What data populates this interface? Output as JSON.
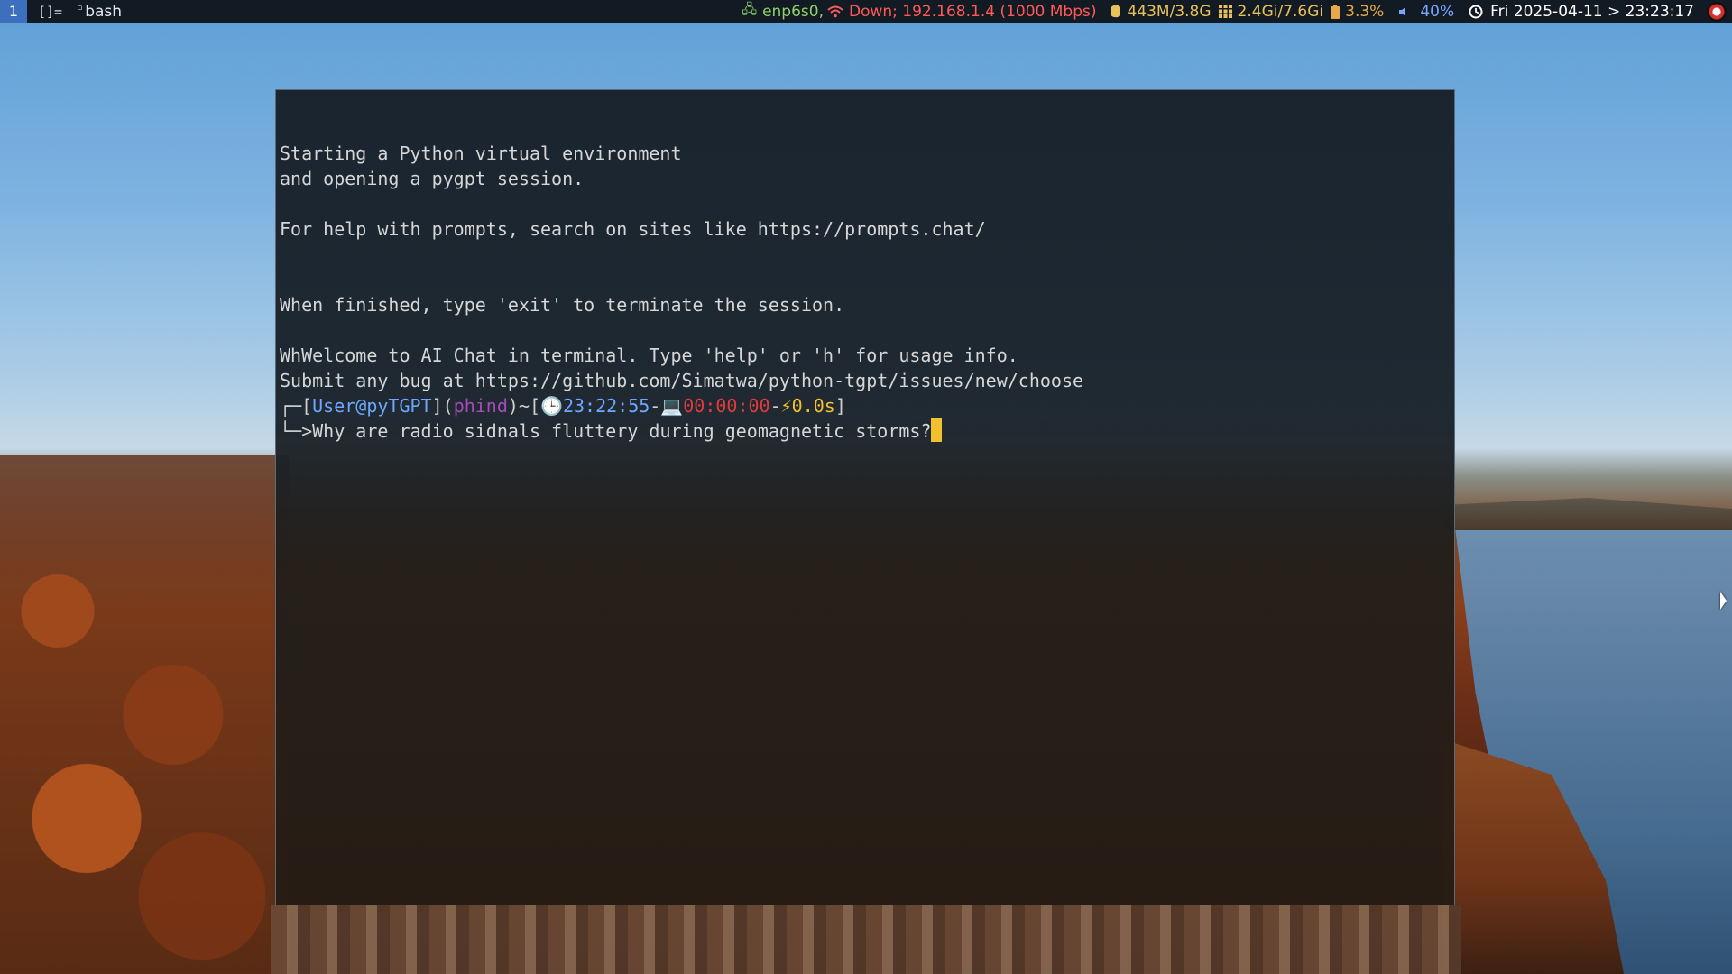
{
  "topbar": {
    "workspace": "1",
    "layout_icon": "[]=",
    "window_title": "bash",
    "network_eth": "enp6s0,",
    "network_wifi": "Down; 192.168.1.4 (1000 Mbps)",
    "memory": "443M/3.8G",
    "cpu": "2.4Gi/7.6Gi",
    "battery": "3.3%",
    "volume": "40%",
    "datetime": "Fri 2025-04-11 > 23:23:17"
  },
  "terminal": {
    "lines": [
      "Starting a Python virtual environment",
      "and opening a pygpt session.",
      "",
      "For help with prompts, search on sites like https://prompts.chat/",
      "",
      "",
      "When finished, type 'exit' to terminate the session.",
      "",
      "WhWelcome to AI Chat in terminal. Type 'help' or 'h' for usage info.",
      "Submit any bug at https://github.com/Simatwa/python-tgpt/issues/new/choose"
    ],
    "prompt": {
      "corner_top": "┌─",
      "user": "User@pyTGPT",
      "model": "phind",
      "cwd": "~",
      "clock_icon": "🕒",
      "time": "23:22:55",
      "laptop_icon": "💻",
      "elapsed": "00:00:00",
      "bolt_icon": "⚡",
      "duration": "0.0s",
      "corner_bottom": "└─",
      "arrow": ">",
      "input": "Why are radio sidnals fluttery during geomagnetic storms?"
    }
  },
  "colors": {
    "topbar_bg": "#121a24",
    "workspace_bg": "#3d6fbf",
    "cursor": "#f2c02d",
    "user": "#6ea7ff",
    "model": "#a54bb8",
    "elapsed": "#e23b3b"
  }
}
